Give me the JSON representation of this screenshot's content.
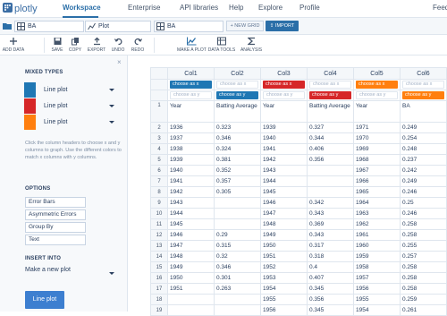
{
  "brand": {
    "name": "plotly"
  },
  "nav": {
    "items": [
      {
        "label": "Workspace",
        "active": true
      },
      {
        "label": "Enterprise"
      },
      {
        "label": "API libraries"
      },
      {
        "label": "Help"
      },
      {
        "label": "Explore"
      },
      {
        "label": "Profile"
      },
      {
        "label": "Feed"
      }
    ]
  },
  "files": {
    "grid_name": "BA",
    "plot_name": "Plot",
    "grid_name_2": "BA",
    "new_grid_label": "+ NEW GRID",
    "import_label": "IMPORT"
  },
  "toolbar": {
    "add_data": "ADD DATA",
    "save": "SAVE",
    "copy": "COPY",
    "export": "EXPORT",
    "undo": "UNDO",
    "redo": "REDO",
    "make_plot": "MAKE A PLOT",
    "data_tools": "DATA TOOLS",
    "analysis": "ANALYSIS"
  },
  "sidebar": {
    "mixed_types_heading": "MIXED TYPES",
    "traces": [
      {
        "label": "Line plot",
        "color": "#1f77b4"
      },
      {
        "label": "Line plot",
        "color": "#d62728"
      },
      {
        "label": "Line plot",
        "color": "#ff7f0e"
      }
    ],
    "help_text": "Click the column headers to choose x and y columns to graph. Use the different colors to match x columns with y columns.",
    "options_heading": "OPTIONS",
    "options": [
      "Error Bars",
      "Asymmetric Errors",
      "Group By",
      "Text"
    ],
    "insert_into_heading": "INSERT INTO",
    "insert_into_value": "Make a new plot",
    "submit_label": "Line plot"
  },
  "grid": {
    "row_labels": {
      "x": "x",
      "y": "y"
    },
    "columns": [
      {
        "name": "Col1",
        "x": "choose as x",
        "y": "choose as y",
        "x_on": true,
        "y_on": false,
        "color": "#1f77b4"
      },
      {
        "name": "Col2",
        "x": "choose as x",
        "y": "choose as y",
        "x_on": false,
        "y_on": true,
        "color": "#1f77b4"
      },
      {
        "name": "Col3",
        "x": "choose as x",
        "y": "choose as y",
        "x_on": true,
        "y_on": false,
        "color": "#d62728"
      },
      {
        "name": "Col4",
        "x": "choose as x",
        "y": "choose as y",
        "x_on": false,
        "y_on": true,
        "color": "#d62728"
      },
      {
        "name": "Col5",
        "x": "choose as x",
        "y": "choose as y",
        "x_on": true,
        "y_on": false,
        "color": "#ff7f0e"
      },
      {
        "name": "Col6",
        "x": "choose as x",
        "y": "choose as y",
        "x_on": false,
        "y_on": true,
        "color": "#ff7f0e"
      }
    ],
    "rows": [
      [
        "1",
        "Year",
        "Batting Average",
        "Year",
        "Batting Average",
        "Year",
        "BA"
      ],
      [
        "2",
        "1936",
        "0.323",
        "1939",
        "0.327",
        "1971",
        "0.249"
      ],
      [
        "3",
        "1937",
        "0.346",
        "1940",
        "0.344",
        "1970",
        "0.254"
      ],
      [
        "4",
        "1938",
        "0.324",
        "1941",
        "0.406",
        "1969",
        "0.248"
      ],
      [
        "5",
        "1939",
        "0.381",
        "1942",
        "0.356",
        "1968",
        "0.237"
      ],
      [
        "6",
        "1940",
        "0.352",
        "1943",
        "",
        "1967",
        "0.242"
      ],
      [
        "7",
        "1941",
        "0.357",
        "1944",
        "",
        "1966",
        "0.249"
      ],
      [
        "8",
        "1942",
        "0.305",
        "1945",
        "",
        "1965",
        "0.246"
      ],
      [
        "9",
        "1943",
        "",
        "1946",
        "0.342",
        "1964",
        "0.25"
      ],
      [
        "10",
        "1944",
        "",
        "1947",
        "0.343",
        "1963",
        "0.246"
      ],
      [
        "11",
        "1945",
        "",
        "1948",
        "0.369",
        "1962",
        "0.258"
      ],
      [
        "12",
        "1946",
        "0.29",
        "1949",
        "0.343",
        "1961",
        "0.258"
      ],
      [
        "13",
        "1947",
        "0.315",
        "1950",
        "0.317",
        "1960",
        "0.255"
      ],
      [
        "14",
        "1948",
        "0.32",
        "1951",
        "0.318",
        "1959",
        "0.257"
      ],
      [
        "15",
        "1949",
        "0.346",
        "1952",
        "0.4",
        "1958",
        "0.258"
      ],
      [
        "16",
        "1950",
        "0.301",
        "1953",
        "0.407",
        "1957",
        "0.258"
      ],
      [
        "17",
        "1951",
        "0.263",
        "1954",
        "0.345",
        "1956",
        "0.258"
      ],
      [
        "18",
        "",
        "",
        "1955",
        "0.356",
        "1955",
        "0.259"
      ],
      [
        "19",
        "",
        "",
        "1956",
        "0.345",
        "1954",
        "0.261"
      ]
    ]
  }
}
